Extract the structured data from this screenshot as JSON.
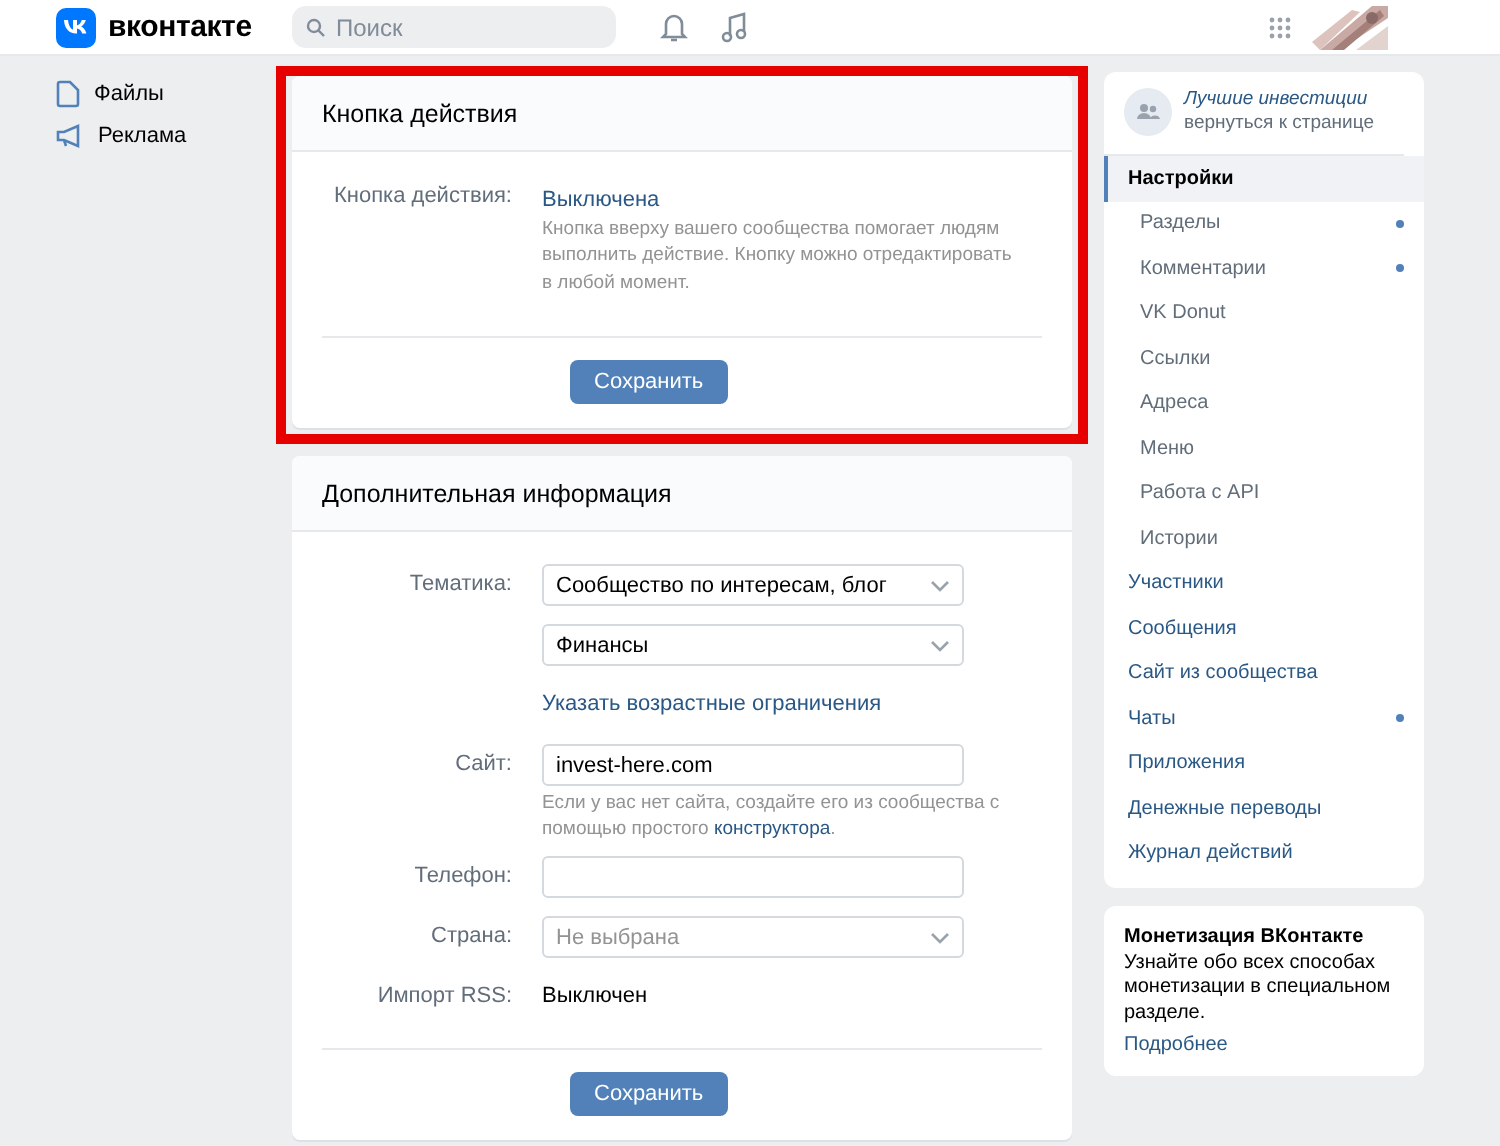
{
  "header": {
    "logo": "вконтакте",
    "search": {
      "placeholder": "Поиск"
    }
  },
  "left_menu": [
    {
      "label": "Файлы"
    },
    {
      "label": "Реклама"
    }
  ],
  "action_card": {
    "title": "Кнопка действия",
    "highlighted": true,
    "label": "Кнопка действия:",
    "value": "Выключена",
    "description": "Кнопка вверху вашего сообщества помогает людям выполнить действие. Кнопку можно отредактировать в любой момент.",
    "button": "Сохранить"
  },
  "info_card": {
    "title": "Дополнительная информация",
    "rows": [
      {
        "kind": "dropdown",
        "label": "Тематика:",
        "value": "Сообщество по интересам, блог"
      },
      {
        "kind": "dropdown",
        "value": "Финансы"
      },
      {
        "kind": "link",
        "value": "Указать возрастные ограничения"
      },
      {
        "kind": "input",
        "label": "Сайт:",
        "value": "invest-here.com",
        "hint": "Если у вас нет сайта, создайте его из сообщества с помощью простого **конструктора**."
      },
      {
        "kind": "input",
        "label": "Телефон:"
      },
      {
        "kind": "dropdown",
        "label": "Страна:",
        "placeholder": "Не выбрана"
      },
      {
        "kind": "text",
        "label": "Импорт RSS:",
        "value": "Выключен"
      }
    ],
    "button": "Сохранить"
  },
  "community": {
    "name": "Лучшие инвестиции",
    "back": "вернуться к странице"
  },
  "nav": [
    {
      "label": "Настройки",
      "kind": "main",
      "selected": true,
      "dot": false
    },
    {
      "label": "Разделы",
      "kind": "sub",
      "selected": false,
      "dot": true
    },
    {
      "label": "Комментарии",
      "kind": "sub",
      "selected": false,
      "dot": true
    },
    {
      "label": "VK Donut",
      "kind": "sub",
      "selected": false,
      "dot": false
    },
    {
      "label": "Ссылки",
      "kind": "sub",
      "selected": false,
      "dot": false
    },
    {
      "label": "Адреса",
      "kind": "sub",
      "selected": false,
      "dot": false
    },
    {
      "label": "Меню",
      "kind": "sub",
      "selected": false,
      "dot": false
    },
    {
      "label": "Работа с API",
      "kind": "sub",
      "selected": false,
      "dot": false
    },
    {
      "label": "Истории",
      "kind": "sub",
      "selected": false,
      "dot": false
    },
    {
      "label": "Участники",
      "kind": "main",
      "selected": false,
      "dot": false
    },
    {
      "label": "Сообщения",
      "kind": "main",
      "selected": false,
      "dot": false
    },
    {
      "label": "Сайт из сообщества",
      "kind": "main",
      "selected": false,
      "dot": false
    },
    {
      "label": "Чаты",
      "kind": "main",
      "selected": false,
      "dot": true
    },
    {
      "label": "Приложения",
      "kind": "main",
      "selected": false,
      "dot": false
    },
    {
      "label": "Денежные переводы",
      "kind": "main",
      "selected": false,
      "dot": false
    },
    {
      "label": "Журнал действий",
      "kind": "main",
      "selected": false,
      "dot": false
    }
  ],
  "promo": {
    "title": "Монетизация ВКонтакте",
    "text": "Узнайте обо всех способах монетизации в специальном разделе.",
    "link": "Подробнее"
  }
}
